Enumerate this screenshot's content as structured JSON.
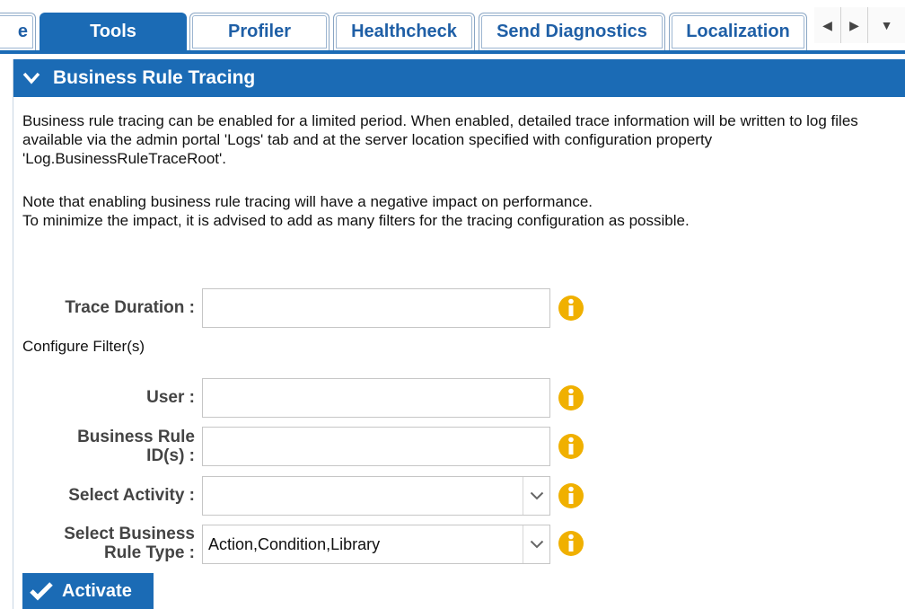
{
  "tabs": [
    {
      "label": "e",
      "active": false
    },
    {
      "label": "Tools",
      "active": true
    },
    {
      "label": "Profiler",
      "active": false
    },
    {
      "label": "Healthcheck",
      "active": false
    },
    {
      "label": "Send Diagnostics",
      "active": false
    },
    {
      "label": "Localization",
      "active": false
    }
  ],
  "panel": {
    "title": "Business Rule Tracing",
    "description": "Business rule tracing can be enabled for a limited period. When enabled, detailed trace information will be written to log files available via the admin portal 'Logs' tab and at the server location specified with configuration property 'Log.BusinessRuleTraceRoot'.",
    "note_line1": "Note that enabling business rule tracing will have a negative impact on performance.",
    "note_line2": "To minimize the impact, it is advised to add as many filters for the tracing configuration as possible."
  },
  "form": {
    "trace_duration_label": "Trace Duration :",
    "trace_duration_value": "",
    "configure_filters_label": "Configure Filter(s)",
    "user_label": "User :",
    "user_value": "",
    "rule_ids_label_1": "Business Rule",
    "rule_ids_label_2": "ID(s) :",
    "rule_ids_value": "",
    "activity_label": "Select Activity :",
    "activity_value": "",
    "rule_type_label_1": "Select Business",
    "rule_type_label_2": "Rule Type :",
    "rule_type_value": "Action,Condition,Library",
    "activate_label": "Activate"
  },
  "colors": {
    "accent": "#1b6bb5",
    "info_icon": "#f0b000"
  },
  "icons": {
    "collapse": "chevron-down-icon",
    "info": "info-icon",
    "activate": "checkmark-icon",
    "scroll_left": "caret-left-icon",
    "scroll_right": "caret-right-icon",
    "tab_menu": "caret-down-icon"
  }
}
